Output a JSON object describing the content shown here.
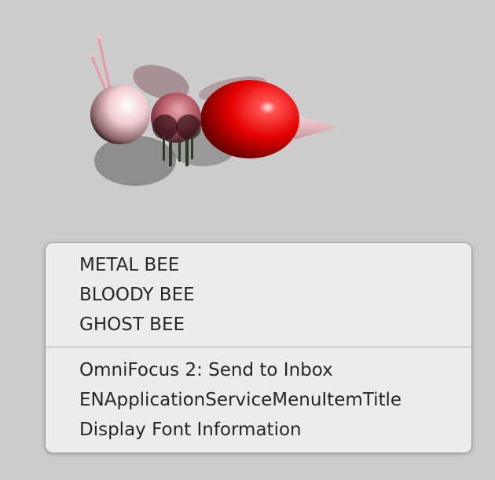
{
  "menu": {
    "group_one": [
      {
        "label": "METAL BEE"
      },
      {
        "label": "BLOODY BEE"
      },
      {
        "label": "GHOST BEE"
      }
    ],
    "group_two": [
      {
        "label": "OmniFocus 2: Send to Inbox"
      },
      {
        "label": "ENApplicationServiceMenuItemTitle"
      },
      {
        "label": "Display Font Information"
      }
    ]
  },
  "colors": {
    "background": "#cccccc",
    "menu_background": "#ececec",
    "menu_text": "#262626",
    "bee_abdomen": "#ff0000",
    "bee_head": "#f4d4d6"
  }
}
